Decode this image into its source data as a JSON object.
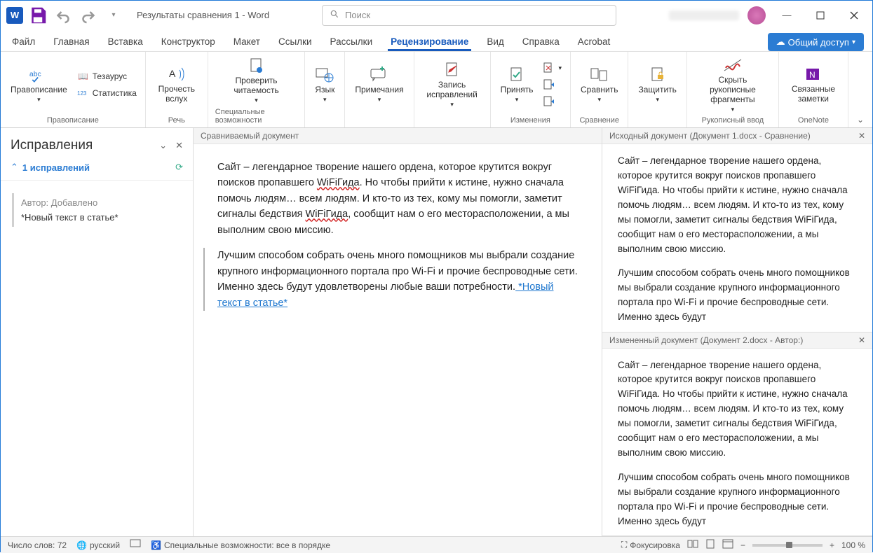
{
  "titlebar": {
    "doc_title": "Результаты сравнения 1  -  Word",
    "search_placeholder": "Поиск"
  },
  "tabs": {
    "file": "Файл",
    "home": "Главная",
    "insert": "Вставка",
    "design": "Конструктор",
    "layout": "Макет",
    "references": "Ссылки",
    "mailings": "Рассылки",
    "review": "Рецензирование",
    "view": "Вид",
    "help": "Справка",
    "acrobat": "Acrobat",
    "share": "Общий доступ"
  },
  "ribbon": {
    "proofing": {
      "label": "Правописание",
      "spelling": "Правописание",
      "thesaurus": "Тезаурус",
      "stats": "Статистика"
    },
    "speech": {
      "label": "Речь",
      "read_aloud": "Прочесть вслух"
    },
    "accessibility": {
      "label": "Специальные возможности",
      "check": "Проверить читаемость"
    },
    "language": {
      "label": "",
      "lang": "Язык"
    },
    "comments": {
      "label": "",
      "comments": "Примечания"
    },
    "tracking": {
      "label": "",
      "track": "Запись исправлений"
    },
    "changes": {
      "label": "Изменения",
      "accept": "Принять"
    },
    "compare": {
      "label": "Сравнение",
      "compare": "Сравнить"
    },
    "protect": {
      "label": "",
      "protect": "Защитить"
    },
    "ink": {
      "label": "Рукописный ввод",
      "hide_ink": "Скрыть рукописные фрагменты"
    },
    "onenote": {
      "label": "OneNote",
      "linked": "Связанные заметки"
    }
  },
  "revisions": {
    "title": "Исправления",
    "count": "1 исправлений",
    "item_author": "Автор: Добавлено",
    "item_text": "*Новый текст в статье*"
  },
  "center": {
    "title": "Сравниваемый документ",
    "p1_a": "Сайт – легендарное творение нашего ордена, которое крутится вокруг поисков пропавшего ",
    "p1_wifi": "WiFiГида",
    "p1_b": ". Но чтобы прийти к истине, нужно сначала помочь людям… всем людям. И кто-то из тех, кому мы помогли, заметит сигналы бедствия ",
    "p1_wifi2": "WiFiГида",
    "p1_c": ", сообщит нам о его месторасположении, а мы выполним свою миссию.",
    "p2_a": "Лучшим способом собрать очень много помощников мы выбрали создание крупного информационного портала про Wi-Fi и прочие беспроводные сети. Именно здесь будут удовлетворены любые ваши потребности.",
    "p2_ins": " *Новый текст в статье*"
  },
  "right1": {
    "title": "Исходный документ (Документ 1.docx - Сравнение)",
    "p1": "Сайт – легендарное творение нашего ордена, которое крутится вокруг поисков пропавшего WiFiГида. Но чтобы прийти к истине, нужно сначала помочь людям… всем людям. И кто-то из тех, кому мы помогли, заметит сигналы бедствия WiFiГида, сообщит нам о его месторасположении, а мы выполним свою миссию.",
    "p2": "Лучшим способом собрать очень много помощников мы выбрали создание крупного информационного портала про Wi-Fi и прочие беспроводные сети. Именно здесь будут"
  },
  "right2": {
    "title": "Измененный документ (Документ 2.docx - Автор:)",
    "p1": "Сайт – легендарное творение нашего ордена, которое крутится вокруг поисков пропавшего WiFiГида. Но чтобы прийти к истине, нужно сначала помочь людям… всем людям. И кто-то из тех, кому мы помогли, заметит сигналы бедствия WiFiГида, сообщит нам о его месторасположении, а мы выполним свою миссию.",
    "p2": "Лучшим способом собрать очень много помощников мы выбрали создание крупного информационного портала про Wi-Fi и прочие беспроводные сети. Именно здесь будут"
  },
  "status": {
    "words": "Число слов: 72",
    "lang": "русский",
    "access": "Специальные возможности: все в порядке",
    "focus": "Фокусировка",
    "zoom": "100 %"
  }
}
